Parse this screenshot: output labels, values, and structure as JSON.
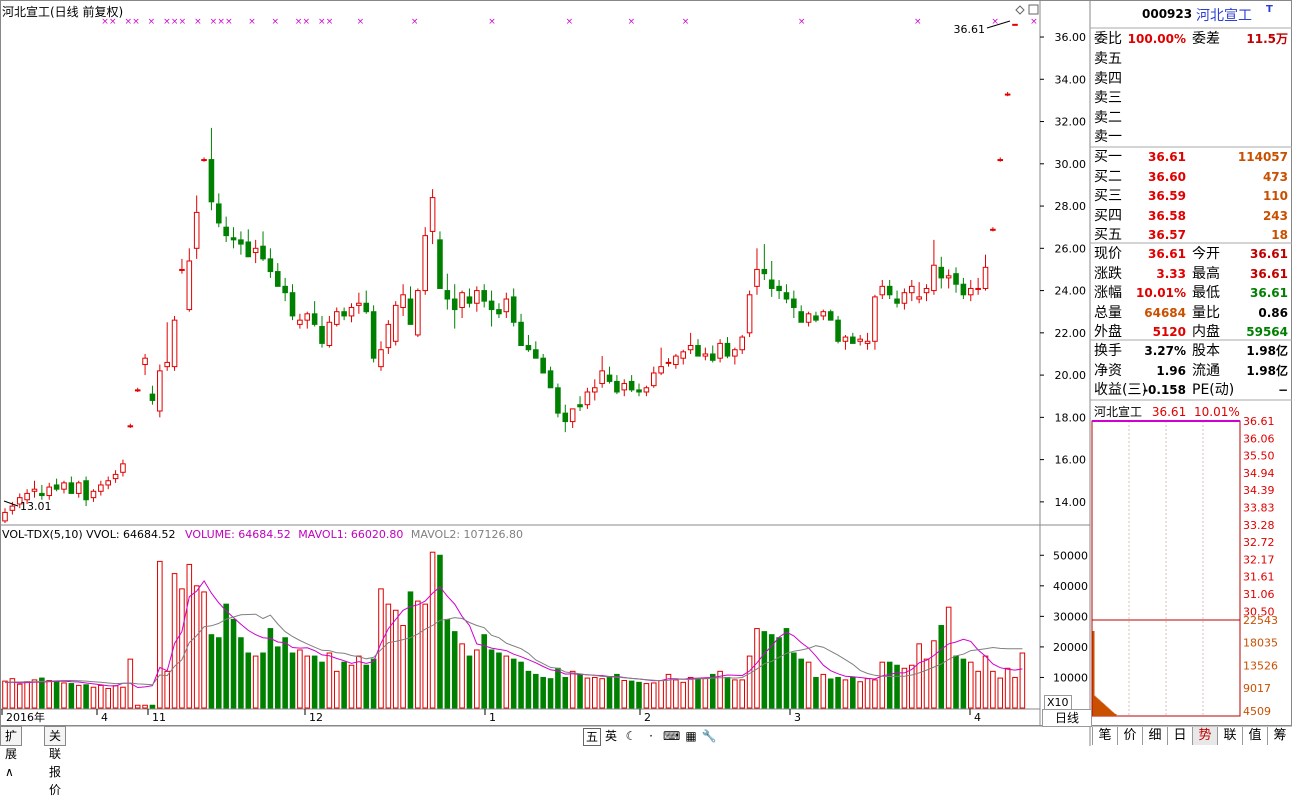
{
  "chart_title": "河北宣工(日线 前复权)",
  "vol_legend": {
    "vvol": "VOL-TDX(5,10)  VVOL: 64684.52",
    "volume": "VOLUME: 64684.52",
    "mavol1": "MAVOL1: 66020.80",
    "mavol2": "MAVOL2: 107126.80"
  },
  "colors": {
    "up": "#e00000",
    "down": "#008000",
    "ma1": "#d000d0",
    "ma2": "#808080",
    "grid": "#c0c0c0",
    "accent": "#2b3fd1"
  },
  "price_axis": {
    "min": 13.0,
    "max": 36.9,
    "ticks": [
      "36.00",
      "34.00",
      "32.00",
      "30.00",
      "28.00",
      "26.00",
      "24.00",
      "22.00",
      "20.00",
      "18.00",
      "16.00",
      "14.00"
    ]
  },
  "vol_axis": {
    "ticks": [
      "50000",
      "40000",
      "30000",
      "20000",
      "10000"
    ],
    "multiplier": "X10"
  },
  "x_labels": [
    "2016年",
    "4",
    "11",
    "12",
    "1",
    "2",
    "3",
    "4"
  ],
  "annotations": {
    "high": "36.61",
    "low": "13.01"
  },
  "chart_data": {
    "type": "candlestick",
    "title": "河北宣工(日线 前复权)",
    "ylim": [
      13.0,
      36.9
    ],
    "ohlc": [
      [
        13.1,
        13.7,
        13.0,
        13.5
      ],
      [
        13.6,
        14.0,
        13.4,
        13.8
      ],
      [
        13.9,
        14.4,
        13.7,
        14.2
      ],
      [
        14.1,
        14.6,
        13.9,
        14.4
      ],
      [
        14.5,
        15.0,
        14.2,
        14.6
      ],
      [
        14.4,
        14.8,
        14.1,
        14.3
      ],
      [
        14.3,
        14.9,
        14.1,
        14.7
      ],
      [
        14.8,
        15.1,
        14.5,
        14.6
      ],
      [
        14.6,
        15.0,
        14.4,
        14.9
      ],
      [
        14.9,
        15.2,
        14.6,
        14.4
      ],
      [
        14.4,
        15.0,
        14.2,
        14.9
      ],
      [
        15.0,
        15.2,
        13.8,
        14.1
      ],
      [
        14.2,
        14.6,
        14.0,
        14.5
      ],
      [
        14.5,
        15.0,
        14.3,
        14.8
      ],
      [
        14.8,
        15.2,
        14.6,
        15.0
      ],
      [
        15.1,
        15.5,
        14.9,
        15.3
      ],
      [
        15.4,
        16.0,
        15.2,
        15.8
      ],
      [
        17.6,
        17.7,
        17.5,
        17.6
      ],
      [
        19.3,
        19.4,
        19.2,
        19.3
      ],
      [
        20.5,
        21.0,
        20.0,
        20.8
      ],
      [
        19.1,
        19.5,
        18.6,
        18.8
      ],
      [
        18.3,
        20.5,
        18.0,
        20.2
      ],
      [
        20.4,
        22.5,
        20.2,
        20.6
      ],
      [
        20.4,
        22.8,
        20.2,
        22.6
      ],
      [
        25.0,
        25.5,
        24.8,
        25.0
      ],
      [
        23.1,
        26.0,
        23.0,
        25.4
      ],
      [
        26.0,
        28.5,
        25.5,
        27.7
      ],
      [
        30.2,
        30.3,
        30.1,
        30.2
      ],
      [
        30.2,
        31.7,
        27.8,
        28.2
      ],
      [
        28.1,
        28.6,
        27.0,
        27.2
      ],
      [
        27.0,
        27.5,
        26.3,
        26.6
      ],
      [
        26.5,
        27.0,
        26.0,
        26.4
      ],
      [
        26.4,
        26.8,
        25.7,
        26.2
      ],
      [
        26.3,
        26.9,
        25.8,
        25.6
      ],
      [
        25.8,
        26.4,
        25.3,
        26.0
      ],
      [
        26.1,
        26.8,
        25.4,
        25.5
      ],
      [
        25.5,
        26.0,
        24.6,
        24.9
      ],
      [
        24.9,
        25.3,
        24.2,
        24.2
      ],
      [
        24.2,
        24.6,
        23.5,
        23.9
      ],
      [
        23.9,
        24.3,
        22.6,
        22.8
      ],
      [
        22.4,
        22.9,
        22.2,
        22.6
      ],
      [
        22.6,
        23.0,
        22.2,
        22.9
      ],
      [
        22.9,
        23.5,
        22.3,
        22.4
      ],
      [
        22.3,
        22.8,
        21.3,
        21.5
      ],
      [
        21.4,
        22.8,
        21.3,
        22.5
      ],
      [
        22.4,
        23.2,
        22.3,
        23.0
      ],
      [
        23.0,
        23.2,
        22.6,
        22.8
      ],
      [
        22.8,
        23.4,
        22.5,
        23.2
      ],
      [
        23.3,
        23.9,
        22.9,
        23.4
      ],
      [
        23.4,
        24.0,
        22.9,
        23.0
      ],
      [
        23.0,
        23.3,
        20.6,
        20.8
      ],
      [
        20.4,
        21.6,
        20.2,
        21.2
      ],
      [
        21.3,
        22.6,
        21.0,
        22.4
      ],
      [
        21.6,
        23.5,
        21.4,
        23.3
      ],
      [
        23.2,
        24.3,
        22.8,
        23.8
      ],
      [
        23.6,
        24.2,
        23.0,
        22.4
      ],
      [
        21.9,
        24.1,
        21.8,
        24.0
      ],
      [
        24.0,
        27.0,
        23.8,
        26.6
      ],
      [
        26.8,
        28.8,
        26.2,
        28.4
      ],
      [
        26.4,
        26.8,
        24.5,
        24.1
      ],
      [
        24.0,
        24.8,
        23.1,
        23.6
      ],
      [
        23.6,
        24.3,
        22.2,
        23.1
      ],
      [
        23.2,
        24.0,
        22.7,
        23.9
      ],
      [
        23.7,
        24.1,
        23.2,
        23.4
      ],
      [
        23.4,
        24.2,
        23.0,
        24.0
      ],
      [
        24.0,
        24.3,
        23.2,
        23.5
      ],
      [
        23.5,
        24.0,
        22.3,
        23.1
      ],
      [
        23.1,
        23.4,
        22.7,
        22.9
      ],
      [
        23.0,
        23.9,
        22.7,
        23.6
      ],
      [
        23.7,
        24.1,
        22.3,
        22.5
      ],
      [
        22.5,
        22.9,
        21.5,
        21.4
      ],
      [
        21.4,
        21.9,
        21.1,
        21.2
      ],
      [
        21.2,
        21.6,
        20.8,
        20.8
      ],
      [
        20.8,
        21.0,
        20.2,
        20.1
      ],
      [
        20.2,
        20.4,
        19.5,
        19.4
      ],
      [
        19.4,
        19.6,
        18.0,
        18.2
      ],
      [
        18.2,
        18.6,
        17.3,
        17.8
      ],
      [
        17.8,
        18.4,
        17.5,
        18.4
      ],
      [
        18.6,
        19.0,
        18.3,
        18.5
      ],
      [
        18.6,
        19.4,
        18.4,
        19.2
      ],
      [
        19.2,
        19.8,
        18.8,
        19.4
      ],
      [
        19.6,
        20.9,
        19.4,
        20.2
      ],
      [
        20.0,
        20.4,
        19.6,
        19.7
      ],
      [
        19.7,
        20.0,
        19.1,
        19.2
      ],
      [
        19.3,
        19.8,
        19.0,
        19.6
      ],
      [
        19.7,
        20.0,
        19.2,
        19.3
      ],
      [
        19.3,
        19.6,
        19.0,
        19.2
      ],
      [
        19.2,
        19.5,
        19.0,
        19.4
      ],
      [
        19.5,
        20.4,
        19.4,
        20.1
      ],
      [
        20.1,
        21.3,
        20.0,
        20.4
      ],
      [
        20.6,
        20.8,
        20.4,
        20.6
      ],
      [
        20.5,
        21.0,
        20.3,
        20.9
      ],
      [
        20.8,
        21.2,
        20.5,
        21.1
      ],
      [
        21.2,
        22.0,
        21.0,
        21.4
      ],
      [
        21.4,
        21.7,
        21.0,
        20.9
      ],
      [
        20.9,
        21.3,
        20.7,
        21.0
      ],
      [
        21.0,
        21.4,
        20.6,
        20.7
      ],
      [
        20.8,
        21.7,
        20.6,
        21.5
      ],
      [
        21.5,
        21.8,
        20.8,
        20.9
      ],
      [
        20.9,
        21.3,
        20.5,
        21.2
      ],
      [
        21.2,
        21.9,
        21.0,
        21.8
      ],
      [
        22.0,
        24.0,
        21.8,
        23.8
      ],
      [
        24.2,
        26.0,
        23.8,
        25.0
      ],
      [
        25.0,
        26.2,
        24.5,
        24.8
      ],
      [
        24.5,
        25.4,
        23.7,
        24.1
      ],
      [
        24.2,
        24.5,
        23.6,
        24.0
      ],
      [
        23.9,
        24.3,
        23.4,
        23.6
      ],
      [
        23.6,
        24.0,
        22.7,
        23.2
      ],
      [
        23.0,
        23.3,
        22.6,
        22.5
      ],
      [
        22.5,
        23.0,
        22.3,
        22.9
      ],
      [
        22.8,
        23.0,
        22.5,
        22.6
      ],
      [
        22.8,
        23.1,
        22.6,
        23.0
      ],
      [
        23.0,
        23.1,
        22.6,
        22.6
      ],
      [
        22.6,
        22.8,
        21.5,
        21.6
      ],
      [
        21.6,
        21.9,
        21.2,
        21.8
      ],
      [
        21.8,
        22.0,
        21.5,
        21.5
      ],
      [
        21.6,
        21.9,
        21.4,
        21.7
      ],
      [
        21.5,
        22.0,
        21.2,
        21.6
      ],
      [
        21.6,
        23.8,
        21.2,
        23.7
      ],
      [
        23.8,
        24.5,
        23.6,
        24.2
      ],
      [
        24.2,
        24.5,
        23.6,
        23.8
      ],
      [
        23.6,
        24.0,
        23.2,
        23.4
      ],
      [
        23.4,
        24.1,
        23.1,
        23.9
      ],
      [
        23.9,
        24.5,
        23.5,
        24.2
      ],
      [
        23.6,
        24.4,
        23.4,
        23.7
      ],
      [
        23.9,
        24.3,
        23.5,
        24.1
      ],
      [
        24.0,
        26.4,
        23.8,
        25.2
      ],
      [
        25.1,
        25.6,
        24.1,
        24.6
      ],
      [
        24.6,
        25.0,
        24.1,
        24.7
      ],
      [
        24.8,
        25.1,
        23.9,
        24.3
      ],
      [
        24.3,
        24.6,
        23.6,
        23.8
      ],
      [
        23.8,
        24.5,
        23.5,
        24.1
      ],
      [
        24.1,
        24.6,
        23.8,
        24.1
      ],
      [
        24.1,
        25.7,
        24.0,
        25.1
      ],
      [
        26.9,
        27.0,
        26.8,
        26.9
      ],
      [
        30.2,
        30.3,
        30.1,
        30.2
      ],
      [
        33.3,
        33.4,
        33.2,
        33.3
      ],
      [
        36.6,
        36.6,
        36.6,
        36.6
      ]
    ],
    "volume": [
      8800,
      9600,
      7800,
      8600,
      9200,
      9800,
      9000,
      8600,
      8200,
      8000,
      7400,
      7600,
      6800,
      7400,
      6400,
      7300,
      6800,
      16000,
      900,
      900,
      900,
      48000,
      12000,
      44000,
      39000,
      47000,
      40000,
      38000,
      24000,
      23000,
      34000,
      29000,
      23000,
      18000,
      17000,
      18000,
      26000,
      20000,
      23000,
      18000,
      19000,
      17000,
      17000,
      15000,
      18000,
      12000,
      15000,
      14000,
      17000,
      14000,
      16000,
      39000,
      34000,
      32000,
      27000,
      38000,
      35000,
      34000,
      51000,
      50000,
      29000,
      25000,
      21000,
      17000,
      19000,
      24000,
      19000,
      18000,
      17000,
      16000,
      15000,
      12000,
      11000,
      10000,
      9600,
      13000,
      10000,
      12000,
      11000,
      9800,
      10000,
      9600,
      10000,
      11000,
      9000,
      8800,
      8400,
      8000,
      8200,
      9000,
      11000,
      9200,
      8400,
      10000,
      9600,
      9800,
      11000,
      12000,
      10000,
      9200,
      9200,
      17000,
      26000,
      25000,
      24000,
      23000,
      26000,
      18000,
      16000,
      15000,
      10000,
      11000,
      9500,
      10000,
      9200,
      10000,
      8600,
      9600,
      9200,
      15000,
      15000,
      14000,
      13000,
      14000,
      21000,
      16000,
      22000,
      27000,
      33000,
      17000,
      16000,
      15000,
      12000,
      17000,
      12000,
      9800,
      13000,
      10000,
      18000
    ],
    "ma1": [
      8300,
      8400,
      8200,
      8300,
      8400,
      8500,
      8600,
      8700,
      8800,
      8600,
      8500,
      8200,
      7900,
      7600,
      7300,
      7200,
      8100,
      8100,
      6700,
      6900,
      7300,
      13300,
      12200,
      21100,
      25000,
      36400,
      38300,
      41600,
      37600,
      34400,
      31800,
      29600,
      27400,
      25400,
      24000,
      23000,
      22800,
      21600,
      21400,
      19800,
      19600,
      19700,
      18800,
      17400,
      17100,
      16200,
      15500,
      14600,
      15200,
      14600,
      15200,
      21200,
      26000,
      29000,
      32000,
      33200,
      33800,
      35000,
      37600,
      39600,
      36600,
      34000,
      30000,
      27000,
      21000,
      20400,
      19600,
      19200,
      18800,
      17600,
      16800,
      15800,
      14800,
      13600,
      12500,
      12100,
      11100,
      11200,
      11000,
      10900,
      10700,
      10600,
      10300,
      10300,
      10000,
      9700,
      9500,
      9200,
      8900,
      9000,
      9600,
      9600,
      9400,
      9700,
      9800,
      9900,
      10000,
      10400,
      10800,
      10700,
      10600,
      12100,
      14800,
      17800,
      20300,
      23200,
      24800,
      23600,
      21400,
      19600,
      17000,
      14000,
      12200,
      11200,
      10400,
      10200,
      10000,
      9700,
      9500,
      10500,
      11000,
      11500,
      11500,
      12600,
      14800,
      15600,
      17200,
      19200,
      21000,
      21600,
      22500,
      21800,
      19000,
      17000,
      14400,
      13200,
      12700,
      12400,
      12800
    ],
    "ma2": [
      8400,
      8500,
      8500,
      8600,
      8600,
      8700,
      8800,
      8900,
      9000,
      9000,
      8900,
      8800,
      8600,
      8400,
      8200,
      8000,
      8100,
      8200,
      7900,
      7800,
      7600,
      10800,
      10600,
      13700,
      15800,
      21400,
      23700,
      26600,
      26900,
      27700,
      29100,
      29800,
      30500,
      30600,
      30700,
      29300,
      30400,
      27500,
      25000,
      23400,
      22100,
      21000,
      19900,
      18900,
      18800,
      18100,
      17900,
      17200,
      16800,
      16100,
      16600,
      19100,
      21400,
      21800,
      22400,
      23000,
      24200,
      25800,
      27000,
      28700,
      29000,
      29600,
      29300,
      28000,
      27000,
      26300,
      23800,
      23000,
      21200,
      20300,
      19400,
      17900,
      15700,
      14500,
      13300,
      13000,
      11800,
      11500,
      11200,
      10800,
      10700,
      10300,
      10200,
      10100,
      9900,
      9700,
      9500,
      9300,
      9100,
      8900,
      9100,
      9400,
      9400,
      9300,
      9600,
      9600,
      9800,
      9900,
      9900,
      9800,
      10000,
      11300,
      12800,
      14500,
      15300,
      16600,
      17900,
      18600,
      19000,
      19500,
      20400,
      19900,
      18600,
      17300,
      15800,
      14300,
      12300,
      11300,
      10700,
      10400,
      10300,
      10400,
      10400,
      10800,
      11500,
      12400,
      13400,
      14400,
      15900,
      17100,
      17600,
      18800,
      19100,
      19400,
      19800,
      19500,
      19400,
      19400,
      19400
    ]
  },
  "quote": {
    "code": "000923",
    "name": "河北宣工",
    "flag": "T",
    "weibi_label": "委比",
    "weibi": "100.00%",
    "weicha_label": "委差",
    "weicha": "11.5万",
    "sell": [
      {
        "label": "卖五"
      },
      {
        "label": "卖四"
      },
      {
        "label": "卖三"
      },
      {
        "label": "卖二"
      },
      {
        "label": "卖一"
      }
    ],
    "buy": [
      {
        "label": "买一",
        "price": "36.61",
        "qty": "114057"
      },
      {
        "label": "买二",
        "price": "36.60",
        "qty": "473"
      },
      {
        "label": "买三",
        "price": "36.59",
        "qty": "110"
      },
      {
        "label": "买四",
        "price": "36.58",
        "qty": "243"
      },
      {
        "label": "买五",
        "price": "36.57",
        "qty": "18"
      }
    ],
    "stats": [
      {
        "l1": "现价",
        "v1": "36.61",
        "l2": "今开",
        "v2": "36.61"
      },
      {
        "l1": "涨跌",
        "v1": "3.33",
        "l2": "最高",
        "v2": "36.61"
      },
      {
        "l1": "涨幅",
        "v1": "10.01%",
        "l2": "最低",
        "v2": "36.61"
      },
      {
        "l1": "总量",
        "v1": "64684",
        "l2": "量比",
        "v2": "0.86"
      },
      {
        "l1": "外盘",
        "v1": "5120",
        "l2": "内盘",
        "v2": "59564"
      }
    ],
    "fund": [
      {
        "l1": "换手",
        "v1": "3.27%",
        "l2": "股本",
        "v2": "1.98亿"
      },
      {
        "l1": "净资",
        "v1": "1.96",
        "l2": "流通",
        "v2": "1.98亿"
      },
      {
        "l1": "收益(三)",
        "v1": "-0.158",
        "l2": "PE(动)",
        "v2": "−"
      }
    ]
  },
  "mini": {
    "title": "河北宣工",
    "price": "36.61",
    "pct": "10.01%",
    "price_ticks": [
      "36.61",
      "36.06",
      "35.50",
      "34.94",
      "34.39",
      "33.83",
      "33.28",
      "32.72",
      "32.17",
      "31.61",
      "31.06",
      "30.50"
    ],
    "vol_ticks": [
      "22543",
      "18035",
      "13526",
      "9017",
      "4509"
    ]
  },
  "bottom_tabs": [
    "扩展∧",
    "关联报价"
  ],
  "toolbar": [
    "五",
    "英",
    "☾",
    "·",
    "⌨",
    "▦",
    "🔧"
  ],
  "right_tabs": [
    "笔",
    "价",
    "细",
    "日",
    "势",
    "联",
    "值",
    "筹"
  ],
  "period_label": "日线"
}
